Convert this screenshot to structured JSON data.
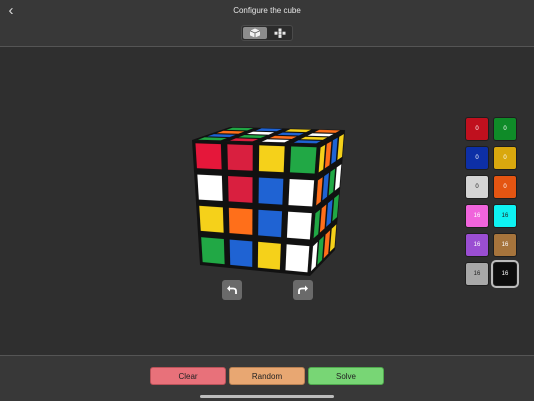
{
  "header": {
    "title": "Configure the cube",
    "back_glyph": "‹"
  },
  "view_toggle": {
    "active": "cube-3d-icon",
    "icons": [
      "cube-3d-icon",
      "cube-net-icon"
    ]
  },
  "cube": {
    "front": [
      [
        "#e5173a",
        "#d91f3f",
        "#f5d11a",
        "#21a845"
      ],
      [
        "#ffffff",
        "#d91f3f",
        "#1f63d3",
        "#ffffff"
      ],
      [
        "#f5d11a",
        "#ff6f1a",
        "#1f63d3",
        "#ffffff"
      ],
      [
        "#21a845",
        "#1f63d3",
        "#f5d11a",
        "#ffffff"
      ]
    ],
    "top": [
      [
        "#21a845",
        "#1f63d3",
        "#ff6f1a",
        "#21a845"
      ],
      [
        "#d91f3f",
        "#21a845",
        "#ffffff",
        "#1f63d3"
      ],
      [
        "#ffffff",
        "#ff6f1a",
        "#1f63d3",
        "#f5d11a"
      ],
      [
        "#1f63d3",
        "#f5d11a",
        "#ffffff",
        "#ff6f1a"
      ]
    ],
    "right": [
      [
        "#f5d11a",
        "#ff6f1a",
        "#1f63d3",
        "#f5d11a"
      ],
      [
        "#ff6f1a",
        "#1f63d3",
        "#21a845",
        "#ffffff"
      ],
      [
        "#21a845",
        "#ff6f1a",
        "#1f63d3",
        "#21a845"
      ],
      [
        "#ffffff",
        "#21a845",
        "#ff6f1a",
        "#f5d11a"
      ]
    ]
  },
  "rotate": {
    "left_icon": "rotate-left-icon",
    "right_icon": "rotate-right-icon"
  },
  "palette": [
    {
      "name": "red-swatch",
      "count": "0",
      "color": "#c0101e",
      "text": "#ffffff"
    },
    {
      "name": "green-swatch",
      "count": "0",
      "color": "#0f8b28",
      "text": "#ffffff"
    },
    {
      "name": "blue-swatch",
      "count": "0",
      "color": "#0d2fa6",
      "text": "#ffffff"
    },
    {
      "name": "yellow-swatch",
      "count": "0",
      "color": "#d9a80e",
      "text": "#ffffff"
    },
    {
      "name": "white-swatch",
      "count": "0",
      "color": "#d4d4d4",
      "text": "#222222"
    },
    {
      "name": "orange-swatch",
      "count": "0",
      "color": "#e45512",
      "text": "#ffffff"
    },
    {
      "name": "pink-swatch",
      "count": "16",
      "color": "#f064dc",
      "text": "#ffffff"
    },
    {
      "name": "cyan-swatch",
      "count": "16",
      "color": "#0ef2f2",
      "text": "#222222"
    },
    {
      "name": "purple-swatch",
      "count": "16",
      "color": "#9a4ed2",
      "text": "#ffffff"
    },
    {
      "name": "brown-swatch",
      "count": "16",
      "color": "#a6743c",
      "text": "#ffffff"
    },
    {
      "name": "gray-swatch",
      "count": "16",
      "color": "#a8a8a8",
      "text": "#222222"
    },
    {
      "name": "black-swatch",
      "count": "16",
      "color": "#0c0c0c",
      "text": "#ffffff"
    }
  ],
  "actions": {
    "clear_label": "Clear",
    "random_label": "Random",
    "solve_label": "Solve",
    "clear_color": "#e8717a",
    "random_color": "#e8a772",
    "solve_color": "#78d675"
  }
}
